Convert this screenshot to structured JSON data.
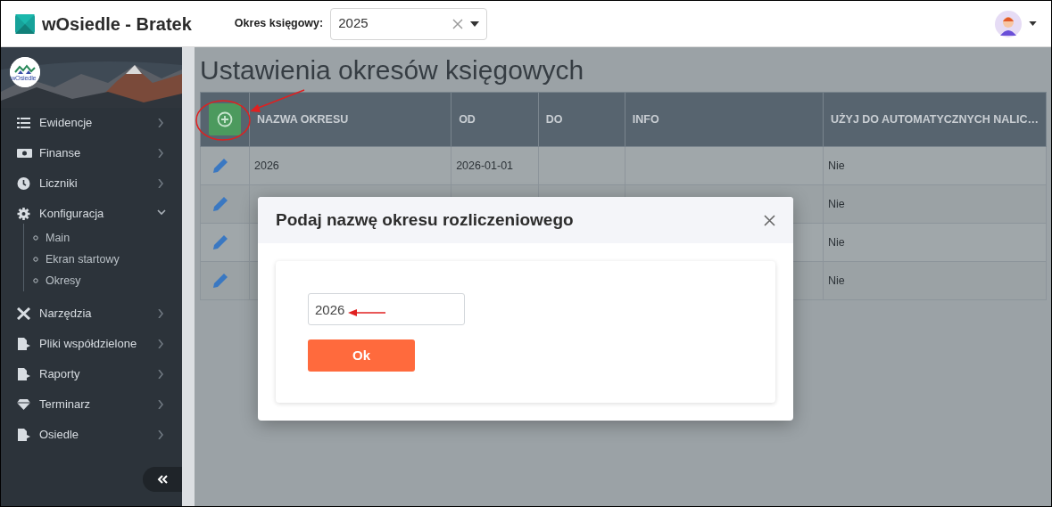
{
  "header": {
    "brand": "wOsiedle - Bratek",
    "period_label": "Okres księgowy:",
    "period_select": {
      "value": "2025"
    }
  },
  "sidebar": {
    "logo_text": "wOsiedle",
    "items": [
      {
        "label": "Ewidencje",
        "expanded": false
      },
      {
        "label": "Finanse",
        "expanded": false
      },
      {
        "label": "Liczniki",
        "expanded": false
      },
      {
        "label": "Konfiguracja",
        "expanded": true,
        "children": [
          {
            "label": "Main"
          },
          {
            "label": "Ekran startowy"
          },
          {
            "label": "Okresy"
          }
        ]
      },
      {
        "label": "Narzędzia",
        "expanded": false
      },
      {
        "label": "Pliki współdzielone",
        "expanded": false
      },
      {
        "label": "Raporty",
        "expanded": false
      },
      {
        "label": "Terminarz",
        "expanded": false
      },
      {
        "label": "Osiedle",
        "expanded": false
      }
    ]
  },
  "page": {
    "title": "Ustawienia okresów księgowych",
    "table": {
      "columns": [
        "NAZWA OKRESU",
        "OD",
        "DO",
        "INFO",
        "UŻYJ DO AUTOMATYCZNYCH NALIC…"
      ],
      "rows": [
        {
          "name": "2026",
          "from": "2026-01-01",
          "auto": "Nie"
        },
        {
          "auto": "Nie"
        },
        {
          "auto": "Nie"
        },
        {
          "auto": "Nie"
        }
      ]
    }
  },
  "modal": {
    "title": "Podaj nazwę okresu rozliczeniowego",
    "input_value": "2026",
    "ok_button": "Ok"
  }
}
